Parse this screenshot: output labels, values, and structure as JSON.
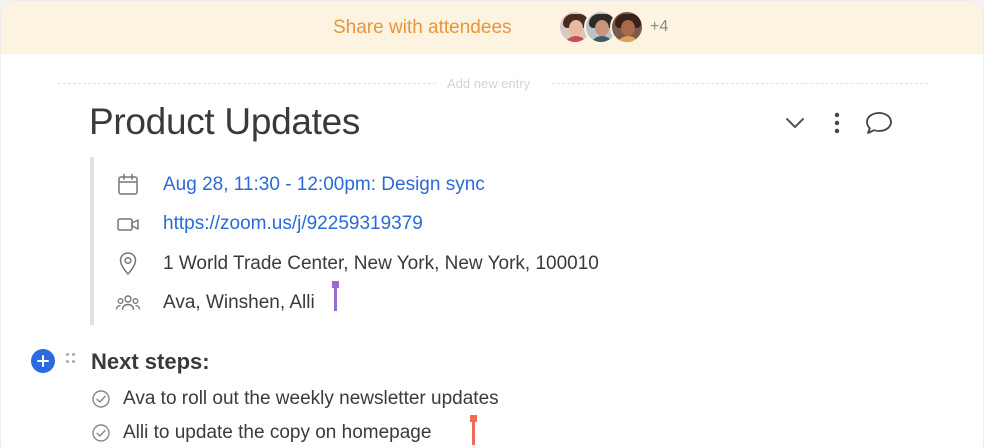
{
  "share": {
    "label": "Share with attendees",
    "more_count": "+4"
  },
  "divider": {
    "label": "Add new entry"
  },
  "entry": {
    "title": "Product Updates"
  },
  "meta": {
    "event": "Aug 28, 11:30 - 12:00pm: Design sync",
    "link": "https://zoom.us/j/92259319379",
    "location": "1 World Trade Center, New York, New York, 100010",
    "attendees": "Ava, Winshen, Alli"
  },
  "next_steps": {
    "heading": "Next steps:",
    "tasks": [
      {
        "text": "Ava to roll out the weekly newsletter updates"
      },
      {
        "text": "Alli to update the copy on homepage"
      }
    ]
  },
  "colors": {
    "accent_orange": "#e8963a",
    "link_blue": "#2a6ad6",
    "add_button_blue": "#2b6ae0",
    "cursor_purple": "#9b6ad6",
    "cursor_red": "#ee6b5a"
  }
}
